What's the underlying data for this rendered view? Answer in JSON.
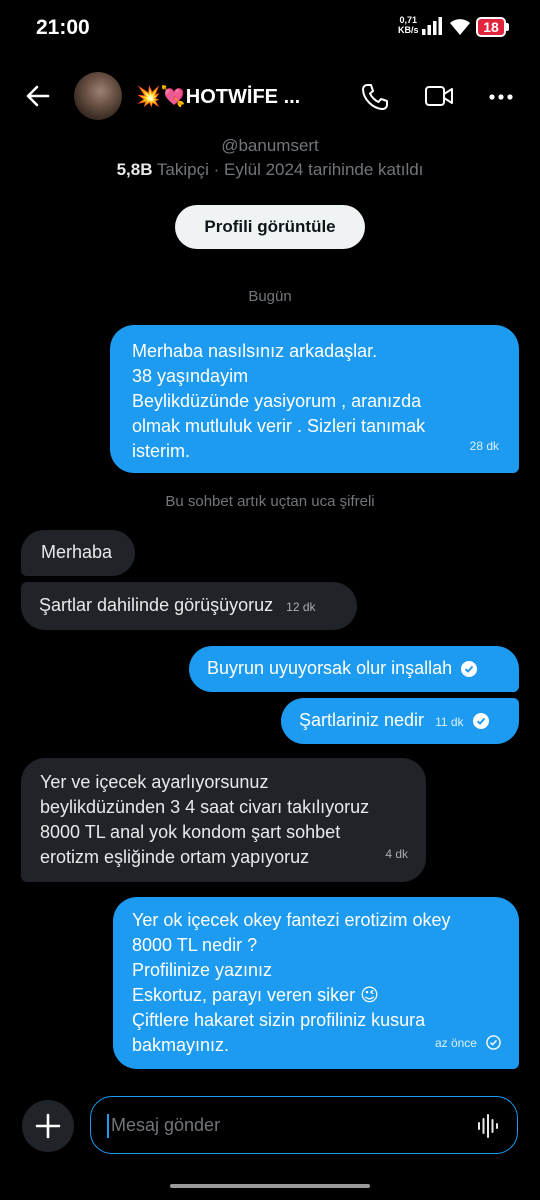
{
  "status": {
    "time": "21:00",
    "net_speed": "0,71",
    "net_unit": "KB/s",
    "battery": "18"
  },
  "header": {
    "title": "💥💘HOTWİFE ...",
    "icons": [
      "back-arrow-icon",
      "phone-icon",
      "video-icon",
      "more-icon"
    ]
  },
  "profile": {
    "handle": "@banumsert",
    "followers_count": "5,8B",
    "followers_rest": " Takipçi · Eylül 2024 tarihinde katıldı",
    "view_button": "Profili görüntüle"
  },
  "separators": {
    "today": "Bugün",
    "encrypted": "Bu sohbet artık uçtan uca şifreli"
  },
  "messages": [
    {
      "dir": "out",
      "lines": [
        "Merhaba nasılsınız arkadaşlar.",
        "38 yaşındayim",
        "Beylikdüzünde yasiyorum , aranızda",
        "olmak mutluluk verir . Sizleri tanımak",
        "isterim."
      ],
      "time": "28 dk"
    },
    {
      "dir": "in",
      "text": "Merhaba"
    },
    {
      "dir": "in",
      "text": "Şartlar dahilinde görüşüyoruz",
      "time": "12 dk"
    },
    {
      "dir": "out",
      "text": "Buyrun uyuyorsak olur inşallah",
      "read": true
    },
    {
      "dir": "out",
      "text": "Şartlariniz nedir",
      "time": "11 dk",
      "read": true
    },
    {
      "dir": "in",
      "lines": [
        "Yer ve içecek ayarlıyorsunuz",
        "beylikdüzünden 3 4 saat civarı takılıyoruz",
        "8000 TL anal yok kondom şart sohbet",
        "erotizm eşliğinde ortam yapıyoruz"
      ],
      "time": "4 dk"
    },
    {
      "dir": "out",
      "lines": [
        "Yer ok içecek okey fantezi erotizim okey",
        "8000 TL  nedir ?",
        "Profilinize yazınız",
        "Eskortuz, parayı veren siker 😉",
        "Çiftlere hakaret sizin profiliniz kusura",
        "bakmayınız."
      ],
      "time": "az önce",
      "sent": true
    }
  ],
  "composer": {
    "placeholder": "Mesaj gönder"
  },
  "colors": {
    "accent": "#1d9bf0",
    "incoming": "#202327",
    "background": "#000000"
  }
}
